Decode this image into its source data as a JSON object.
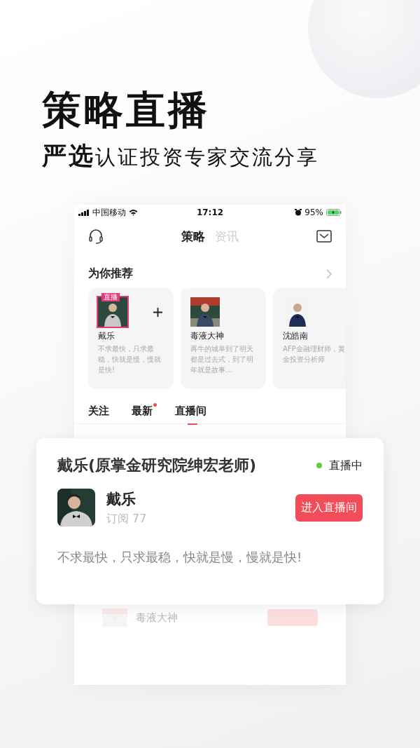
{
  "headline": "策略直播",
  "subtitle": {
    "bold": "严选",
    "rest": "认证投资专家交流分享"
  },
  "status_bar": {
    "carrier": "中国移动",
    "time": "17:12",
    "battery": "95%"
  },
  "nav": {
    "tabs": [
      {
        "label": "策略",
        "selected": true
      },
      {
        "label": "资讯",
        "selected": false
      }
    ]
  },
  "recommend": {
    "title": "为你推荐",
    "cards": [
      {
        "name": "戴乐",
        "desc": "不求最快，只求最稳，快就是慢，慢就是快!",
        "badge": "直播",
        "follow": true
      },
      {
        "name": "毒液大神",
        "desc": "再牛的城单到了明天都是过去式，到了明年就是故事...",
        "follow": false
      },
      {
        "name": "沈皓南",
        "desc": "AFP金融理财师，黄金投资分析师",
        "follow": false
      }
    ]
  },
  "feed_tabs": [
    {
      "label": "关注",
      "selected": false,
      "dot": false
    },
    {
      "label": "最新",
      "selected": false,
      "dot": true
    },
    {
      "label": "直播间",
      "selected": true,
      "dot": false
    }
  ],
  "live_card": {
    "title": "戴乐(原掌金研究院绅宏老师)",
    "status": "直播中",
    "name": "戴乐",
    "subscribers": "订阅 77",
    "button": "进入直播间",
    "quote": "不求最快，只求最稳，快就是慢，慢就是快!"
  },
  "faded_row": {
    "name": "毒液大神"
  }
}
